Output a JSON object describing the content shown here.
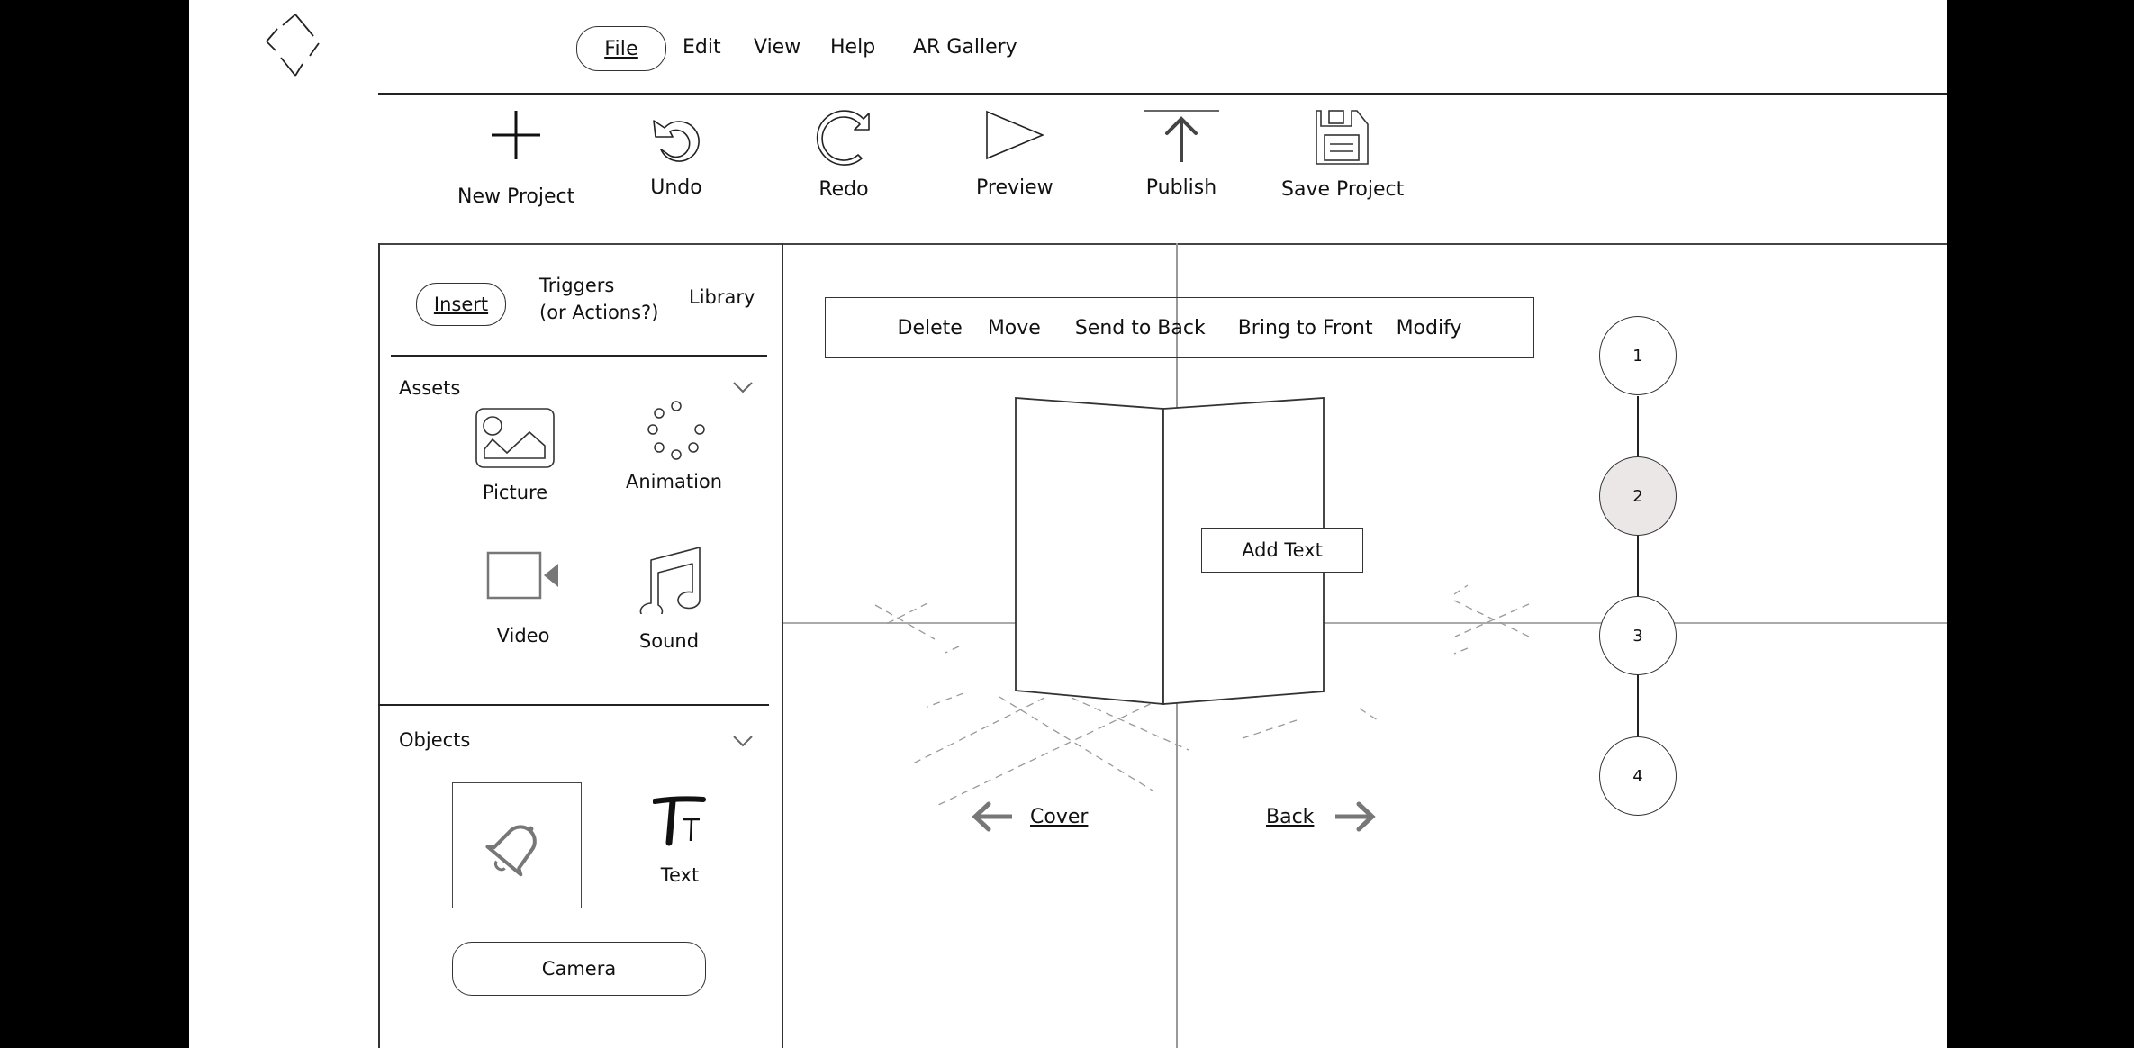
{
  "menu": {
    "logo": "diamond-logo",
    "items": [
      "File",
      "Edit",
      "View",
      "Help",
      "AR Gallery"
    ],
    "active": "File"
  },
  "toolbar": {
    "items": [
      {
        "label": "New Project",
        "icon": "plus-icon"
      },
      {
        "label": "Undo",
        "icon": "undo-icon"
      },
      {
        "label": "Redo",
        "icon": "redo-icon"
      },
      {
        "label": "Preview",
        "icon": "play-icon"
      },
      {
        "label": "Publish",
        "icon": "upload-icon"
      },
      {
        "label": "Save Project",
        "icon": "floppy-disk-icon"
      }
    ]
  },
  "sidebar": {
    "tabs": [
      "Insert",
      "Triggers\n(or Actions?)",
      "Library"
    ],
    "tab_triggers_line1": "Triggers",
    "tab_triggers_line2": "(or Actions?)",
    "active_tab": "Insert",
    "assets": {
      "title": "Assets",
      "items": [
        {
          "label": "Picture",
          "icon": "picture-icon"
        },
        {
          "label": "Animation",
          "icon": "loading-dots-icon"
        },
        {
          "label": "Video",
          "icon": "video-camera-icon"
        },
        {
          "label": "Sound",
          "icon": "music-note-icon"
        }
      ]
    },
    "objects": {
      "title": "Objects",
      "items": [
        {
          "label": "",
          "icon": "bell-icon",
          "selected": true
        },
        {
          "label": "Text",
          "icon": "text-size-icon"
        }
      ],
      "camera_label": "Camera"
    }
  },
  "canvas": {
    "context_actions": [
      "Delete",
      "Move",
      "Send to Back",
      "Bring to Front",
      "Modify"
    ],
    "add_text_label": "Add Text",
    "prev_link": "Cover",
    "next_link": "Back"
  },
  "pages": {
    "items": [
      "1",
      "2",
      "3",
      "4"
    ],
    "active_index": 1,
    "active_color": "#ece7e7"
  }
}
